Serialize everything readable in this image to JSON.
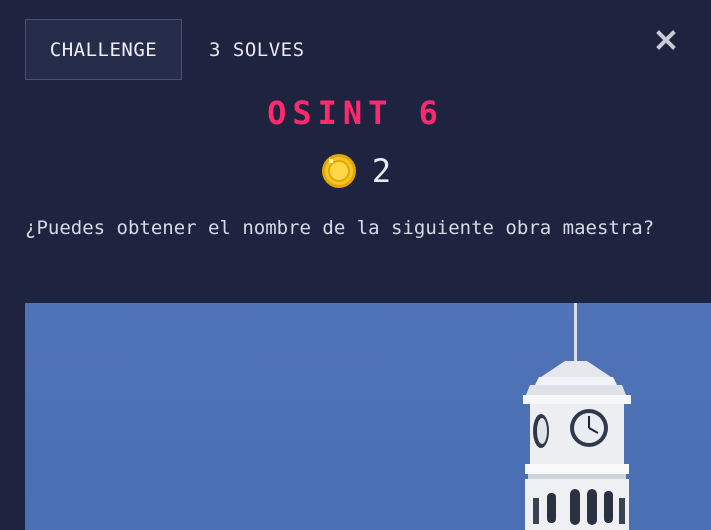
{
  "tabs": {
    "challenge_label": "CHALLENGE",
    "solves_label": "3 SOLVES"
  },
  "challenge": {
    "title": "OSINT 6",
    "points": "2",
    "description": "¿Puedes obtener el nombre de la siguiente obra maestra?"
  },
  "icons": {
    "close": "close-icon",
    "coin": "coin-icon"
  },
  "colors": {
    "background": "#1e2440",
    "title": "#ff2a6d",
    "sky": "#4d72b5",
    "coin": "#f4c430"
  }
}
